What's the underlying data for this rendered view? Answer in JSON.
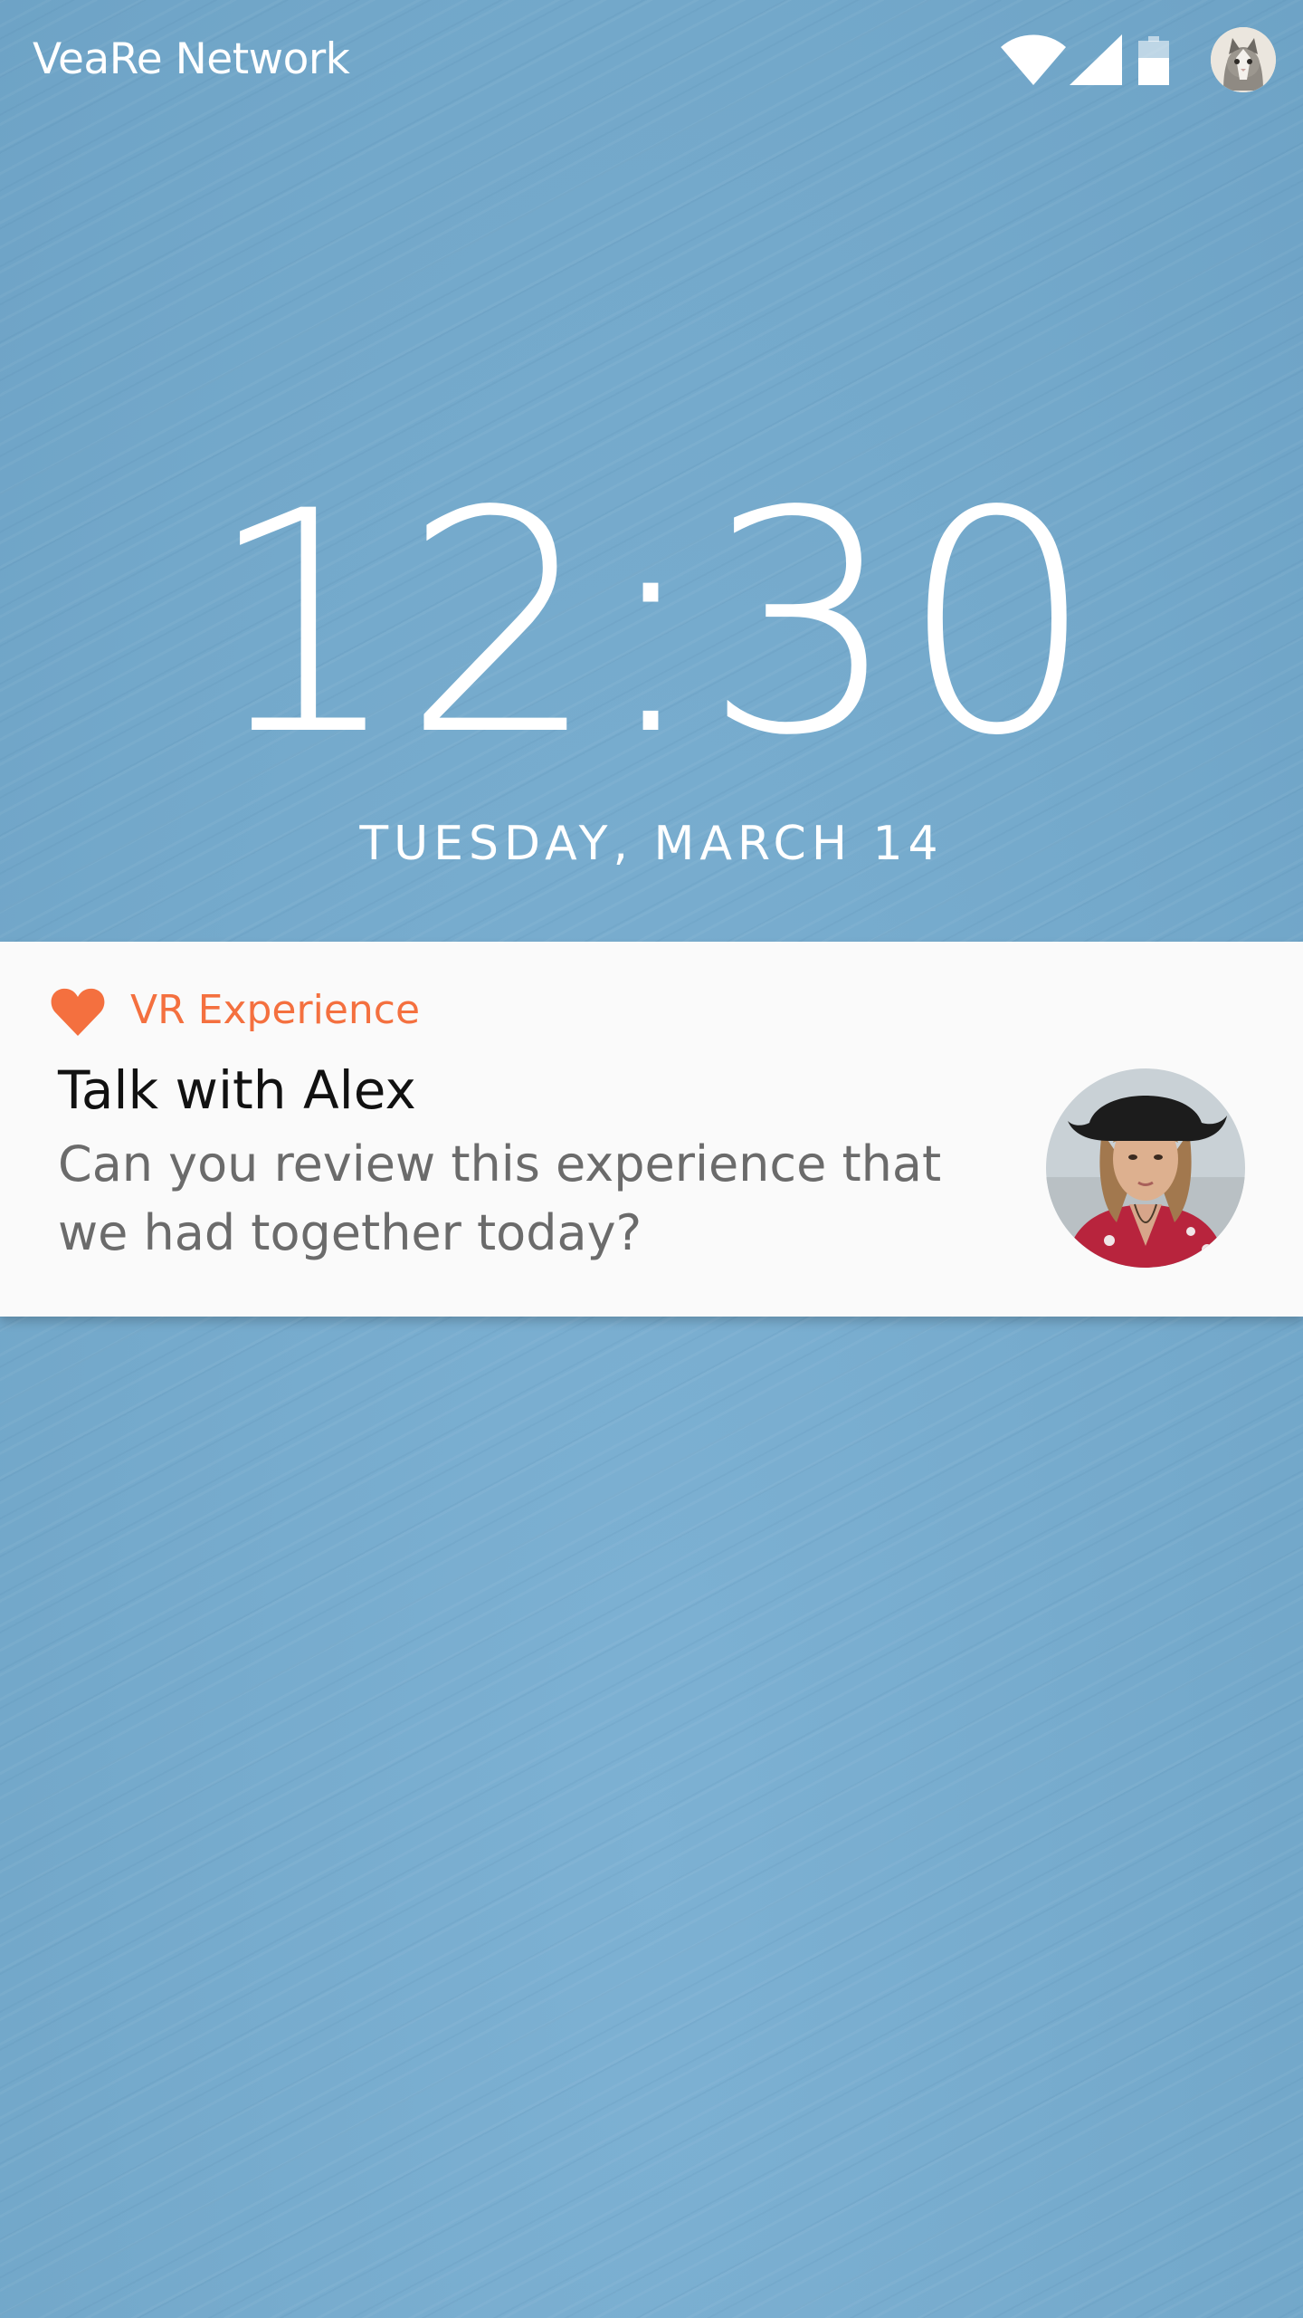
{
  "status_bar": {
    "carrier": "VeaRe Network",
    "icons": [
      "wifi-icon",
      "signal-icon",
      "battery-icon",
      "profile-avatar"
    ]
  },
  "lockscreen": {
    "time": "12:30",
    "date": "TUESDAY, MARCH 14"
  },
  "notification": {
    "app_icon": "heart-icon",
    "app_name": "VR Experience",
    "title": "Talk with Alex",
    "body": "Can you review this experience that we had together today?",
    "avatar": "contact-avatar"
  },
  "colors": {
    "wallpaper": "#78acce",
    "accent": "#f4703f",
    "card": "#fafafa",
    "title_text": "#111111",
    "body_text": "#6b6b6b"
  }
}
